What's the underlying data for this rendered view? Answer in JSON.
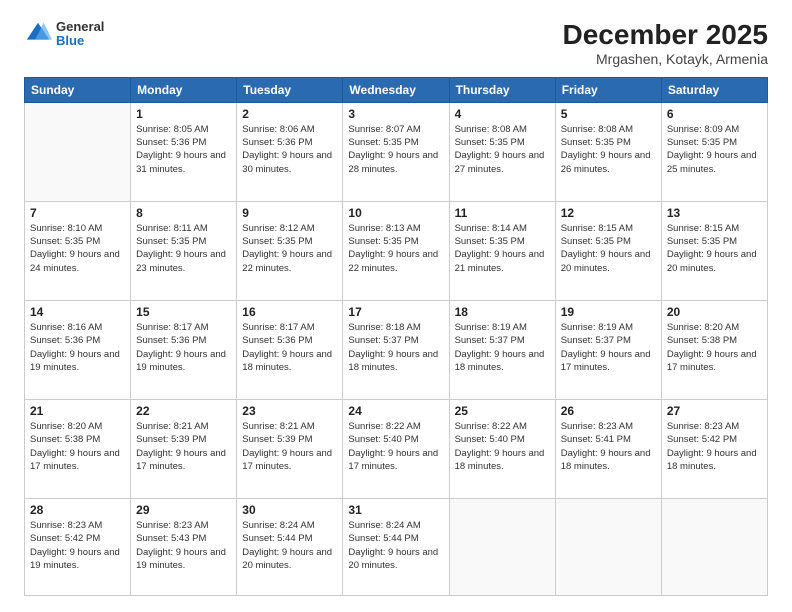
{
  "header": {
    "logo": {
      "general": "General",
      "blue": "Blue"
    },
    "title": "December 2025",
    "subtitle": "Mrgashen, Kotayk, Armenia"
  },
  "days_of_week": [
    "Sunday",
    "Monday",
    "Tuesday",
    "Wednesday",
    "Thursday",
    "Friday",
    "Saturday"
  ],
  "weeks": [
    [
      {
        "day": "",
        "empty": true
      },
      {
        "day": "1",
        "sunrise": "8:05 AM",
        "sunset": "5:36 PM",
        "daylight": "9 hours and 31 minutes."
      },
      {
        "day": "2",
        "sunrise": "8:06 AM",
        "sunset": "5:36 PM",
        "daylight": "9 hours and 30 minutes."
      },
      {
        "day": "3",
        "sunrise": "8:07 AM",
        "sunset": "5:35 PM",
        "daylight": "9 hours and 28 minutes."
      },
      {
        "day": "4",
        "sunrise": "8:08 AM",
        "sunset": "5:35 PM",
        "daylight": "9 hours and 27 minutes."
      },
      {
        "day": "5",
        "sunrise": "8:08 AM",
        "sunset": "5:35 PM",
        "daylight": "9 hours and 26 minutes."
      },
      {
        "day": "6",
        "sunrise": "8:09 AM",
        "sunset": "5:35 PM",
        "daylight": "9 hours and 25 minutes."
      }
    ],
    [
      {
        "day": "7",
        "sunrise": "8:10 AM",
        "sunset": "5:35 PM",
        "daylight": "9 hours and 24 minutes."
      },
      {
        "day": "8",
        "sunrise": "8:11 AM",
        "sunset": "5:35 PM",
        "daylight": "9 hours and 23 minutes."
      },
      {
        "day": "9",
        "sunrise": "8:12 AM",
        "sunset": "5:35 PM",
        "daylight": "9 hours and 22 minutes."
      },
      {
        "day": "10",
        "sunrise": "8:13 AM",
        "sunset": "5:35 PM",
        "daylight": "9 hours and 22 minutes."
      },
      {
        "day": "11",
        "sunrise": "8:14 AM",
        "sunset": "5:35 PM",
        "daylight": "9 hours and 21 minutes."
      },
      {
        "day": "12",
        "sunrise": "8:15 AM",
        "sunset": "5:35 PM",
        "daylight": "9 hours and 20 minutes."
      },
      {
        "day": "13",
        "sunrise": "8:15 AM",
        "sunset": "5:35 PM",
        "daylight": "9 hours and 20 minutes."
      }
    ],
    [
      {
        "day": "14",
        "sunrise": "8:16 AM",
        "sunset": "5:36 PM",
        "daylight": "9 hours and 19 minutes."
      },
      {
        "day": "15",
        "sunrise": "8:17 AM",
        "sunset": "5:36 PM",
        "daylight": "9 hours and 19 minutes."
      },
      {
        "day": "16",
        "sunrise": "8:17 AM",
        "sunset": "5:36 PM",
        "daylight": "9 hours and 18 minutes."
      },
      {
        "day": "17",
        "sunrise": "8:18 AM",
        "sunset": "5:37 PM",
        "daylight": "9 hours and 18 minutes."
      },
      {
        "day": "18",
        "sunrise": "8:19 AM",
        "sunset": "5:37 PM",
        "daylight": "9 hours and 18 minutes."
      },
      {
        "day": "19",
        "sunrise": "8:19 AM",
        "sunset": "5:37 PM",
        "daylight": "9 hours and 17 minutes."
      },
      {
        "day": "20",
        "sunrise": "8:20 AM",
        "sunset": "5:38 PM",
        "daylight": "9 hours and 17 minutes."
      }
    ],
    [
      {
        "day": "21",
        "sunrise": "8:20 AM",
        "sunset": "5:38 PM",
        "daylight": "9 hours and 17 minutes."
      },
      {
        "day": "22",
        "sunrise": "8:21 AM",
        "sunset": "5:39 PM",
        "daylight": "9 hours and 17 minutes."
      },
      {
        "day": "23",
        "sunrise": "8:21 AM",
        "sunset": "5:39 PM",
        "daylight": "9 hours and 17 minutes."
      },
      {
        "day": "24",
        "sunrise": "8:22 AM",
        "sunset": "5:40 PM",
        "daylight": "9 hours and 17 minutes."
      },
      {
        "day": "25",
        "sunrise": "8:22 AM",
        "sunset": "5:40 PM",
        "daylight": "9 hours and 18 minutes."
      },
      {
        "day": "26",
        "sunrise": "8:23 AM",
        "sunset": "5:41 PM",
        "daylight": "9 hours and 18 minutes."
      },
      {
        "day": "27",
        "sunrise": "8:23 AM",
        "sunset": "5:42 PM",
        "daylight": "9 hours and 18 minutes."
      }
    ],
    [
      {
        "day": "28",
        "sunrise": "8:23 AM",
        "sunset": "5:42 PM",
        "daylight": "9 hours and 19 minutes."
      },
      {
        "day": "29",
        "sunrise": "8:23 AM",
        "sunset": "5:43 PM",
        "daylight": "9 hours and 19 minutes."
      },
      {
        "day": "30",
        "sunrise": "8:24 AM",
        "sunset": "5:44 PM",
        "daylight": "9 hours and 20 minutes."
      },
      {
        "day": "31",
        "sunrise": "8:24 AM",
        "sunset": "5:44 PM",
        "daylight": "9 hours and 20 minutes."
      },
      {
        "day": "",
        "empty": true
      },
      {
        "day": "",
        "empty": true
      },
      {
        "day": "",
        "empty": true
      }
    ]
  ]
}
